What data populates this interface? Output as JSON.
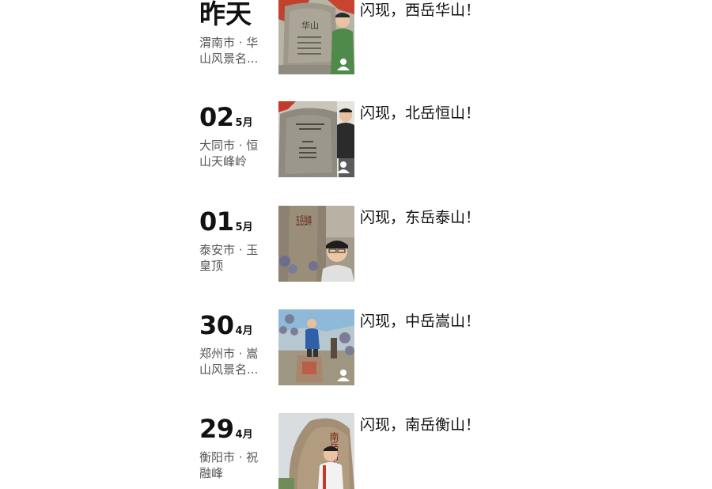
{
  "entries": [
    {
      "day": "昨天",
      "month": "",
      "location": "渭南市 · 华山风景名...",
      "caption": "闪现，西岳华山！",
      "photo_icon": "person-icon"
    },
    {
      "day": "02",
      "month": "5月",
      "location": "大同市 · 恒山天峰岭",
      "caption": "闪现，北岳恒山！",
      "photo_icon": "person-icon"
    },
    {
      "day": "01",
      "month": "5月",
      "location": "泰安市 · 玉皇顶",
      "caption": "闪现，东岳泰山！",
      "photo_icon": ""
    },
    {
      "day": "30",
      "month": "4月",
      "location": "郑州市 · 嵩山风景名...",
      "caption": "闪现，中岳嵩山！",
      "photo_icon": "person-icon"
    },
    {
      "day": "29",
      "month": "4月",
      "location": "衡阳市 · 祝融峰",
      "caption": "闪现，南岳衡山！",
      "photo_icon": ""
    }
  ],
  "photo_texts": {
    "huashan": "华山",
    "taishan": "五岳独尊",
    "hengshan_south": "南岳衡山"
  },
  "colors": {
    "text_primary": "#111111",
    "text_secondary": "#555555",
    "background": "#ffffff"
  }
}
